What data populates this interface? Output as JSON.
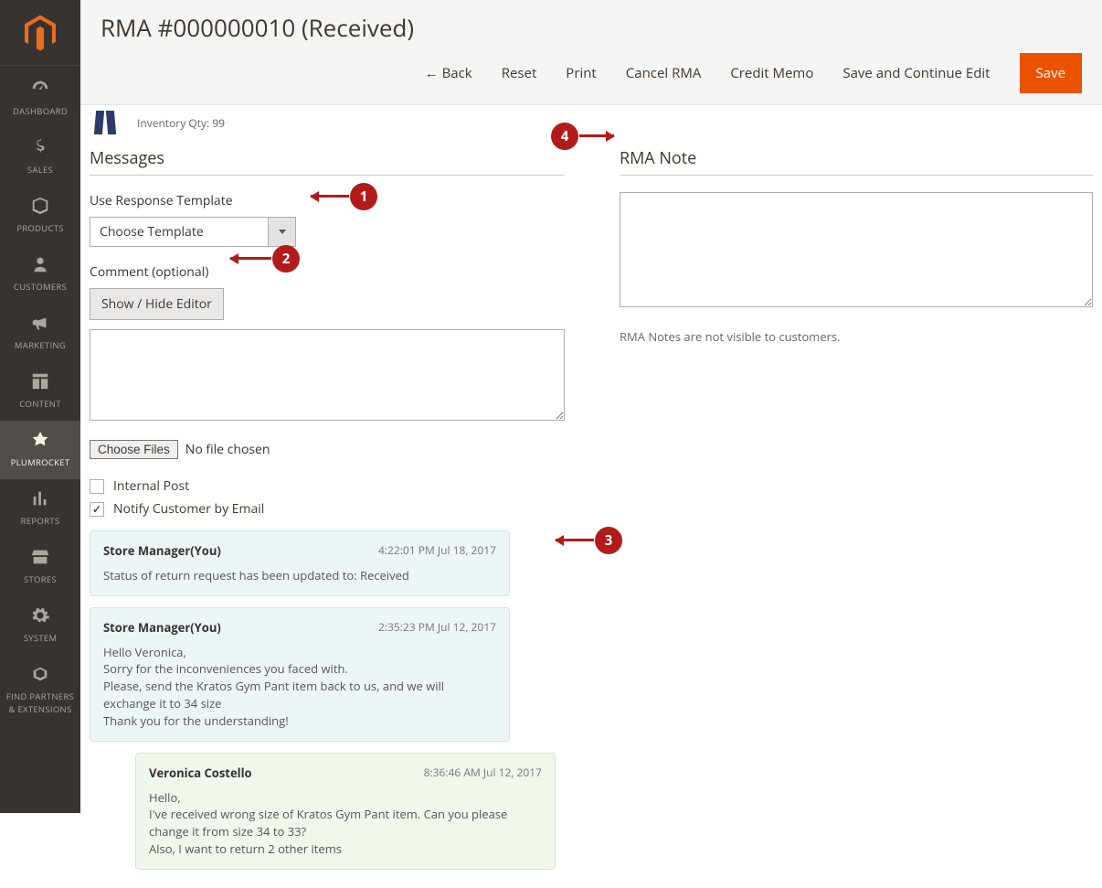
{
  "page_title": "RMA #000000010 (Received)",
  "inventory_qty": "Inventory Qty: 99",
  "actions": {
    "back": "Back",
    "reset": "Reset",
    "print": "Print",
    "cancel": "Cancel RMA",
    "credit_memo": "Credit Memo",
    "save_continue": "Save and Continue Edit",
    "save": "Save"
  },
  "sidebar": [
    {
      "key": "dashboard",
      "label": "DASHBOARD"
    },
    {
      "key": "sales",
      "label": "SALES"
    },
    {
      "key": "products",
      "label": "PRODUCTS"
    },
    {
      "key": "customers",
      "label": "CUSTOMERS"
    },
    {
      "key": "marketing",
      "label": "MARKETING"
    },
    {
      "key": "content",
      "label": "CONTENT"
    },
    {
      "key": "plumrocket",
      "label": "PLUMROCKET"
    },
    {
      "key": "reports",
      "label": "REPORTS"
    },
    {
      "key": "stores",
      "label": "STORES"
    },
    {
      "key": "system",
      "label": "SYSTEM"
    },
    {
      "key": "partners",
      "label": "FIND PARTNERS\n& EXTENSIONS"
    }
  ],
  "messages": {
    "heading": "Messages",
    "template_label": "Use Response Template",
    "template_selected": "Choose Template",
    "comment_label": "Comment (optional)",
    "toggle_editor": "Show / Hide Editor",
    "file_btn": "Choose Files",
    "file_status": "No file chosen",
    "internal_post": "Internal Post",
    "notify_email": "Notify Customer by Email",
    "thread": [
      {
        "type": "admin",
        "author": "Store Manager(You)",
        "date": "4:22:01 PM  Jul 18, 2017",
        "body": "Status of return request has been updated to: Received"
      },
      {
        "type": "admin",
        "author": "Store Manager(You)",
        "date": "2:35:23 PM  Jul 12, 2017",
        "body": "Hello Veronica,\nSorry for the inconveniences you faced with.\nPlease, send the Kratos Gym Pant item back to us, and we will exchange it to 34 size\nThank you for the understanding!"
      },
      {
        "type": "customer",
        "author": "Veronica Costello",
        "date": "8:36:46 AM  Jul 12, 2017",
        "body": "Hello,\nI've received wrong size of Kratos Gym Pant item. Can you please change it from size 34 to 33?\nAlso, I want to return 2 other items"
      }
    ]
  },
  "note": {
    "heading": "RMA Note",
    "hint": "RMA Notes are not visible to customers."
  },
  "callouts": {
    "c1": "1",
    "c2": "2",
    "c3": "3",
    "c4": "4"
  }
}
